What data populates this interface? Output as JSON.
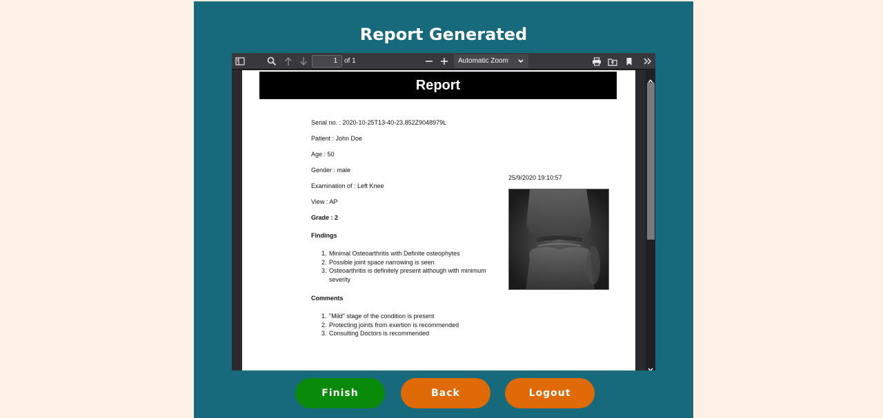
{
  "page": {
    "title": "Report Generated"
  },
  "viewer": {
    "toolbar": {
      "page_number": "1",
      "page_of": "of 1",
      "zoom": "Automatic Zoom"
    },
    "report": {
      "banner": "Report",
      "serial": "Serial no. : 2020-10-25T13-40-23.852Z9048979L",
      "patient": "Patient : John Doe",
      "age": "Age : 50",
      "gender": "Gender : male",
      "examination": "Examination of : Left Knee",
      "view": "View : AP",
      "grade": "Grade : 2",
      "findings_heading": "Findings",
      "findings": [
        {
          "num": "1.",
          "text": "Minimal Osteoarthritis with Definite osteophytes"
        },
        {
          "num": "2.",
          "text": "Possible joint space narrowing is seen"
        },
        {
          "num": "3.",
          "text": "Osteoarthritis is definitely present although with minimum severity"
        }
      ],
      "comments_heading": "Comments",
      "comments": [
        {
          "num": "1.",
          "text": "\"Mild\" stage of the condition is present"
        },
        {
          "num": "2.",
          "text": "Protecting joints from exertion is recommended"
        },
        {
          "num": "3.",
          "text": "Consulting Doctors is recommended"
        }
      ],
      "timestamp": "25/9/2020 19:10:57"
    }
  },
  "buttons": {
    "finish": "Finish",
    "back": "Back",
    "logout": "Logout"
  },
  "colors": {
    "background": "#fdf0e4",
    "panel": "#176a7b",
    "finish": "#0a8a0a",
    "back": "#e06a08",
    "logout": "#e06a08"
  },
  "icons": [
    "sidebar-toggle-icon",
    "search-icon",
    "arrow-up-icon",
    "arrow-down-icon",
    "zoom-out-icon",
    "zoom-in-icon",
    "chevron-down-icon",
    "print-icon",
    "open-file-icon",
    "bookmark-icon",
    "tools-icon",
    "xray-image"
  ]
}
